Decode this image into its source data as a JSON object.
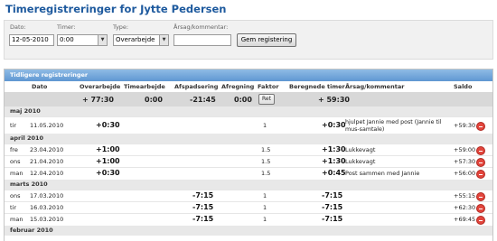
{
  "page_title": "Timeregistreringer for Jytte Pedersen",
  "form": {
    "dato_label": "Dato:",
    "dato_value": "12-05-2010",
    "timer_label": "Timer:",
    "timer_value": "0:00",
    "type_label": "Type:",
    "type_value": "Overarbejde",
    "kommentar_label": "Årsag/kommentar:",
    "kommentar_value": "",
    "submit_label": "Gem registering"
  },
  "panel_title": "Tidligere registreringer",
  "columns": [
    "Dato",
    "Overarbejde",
    "Timearbejde",
    "Afspadsering",
    "Afregning",
    "Faktor",
    "Beregnede timer",
    "Årsag/kommentar",
    "Saldo"
  ],
  "summary": {
    "overarbejde": "+ 77:30",
    "timearbejde": "0:00",
    "afspadsering": "-21:45",
    "afregning": "0:00",
    "faktor_button": "Ret",
    "beregnede": "+ 59:30"
  },
  "months": [
    {
      "name": "maj 2010",
      "rows": [
        {
          "day": "tir",
          "date": "11.05.2010",
          "overarbejde": "+0:30",
          "afspadsering": "",
          "faktor": "1",
          "beregnede": "+0:30",
          "kommentar": "hjulpet Jannie med post (Jannie til mus-samtale)",
          "saldo": "+59:30"
        }
      ]
    },
    {
      "name": "april 2010",
      "rows": [
        {
          "day": "fre",
          "date": "23.04.2010",
          "overarbejde": "+1:00",
          "afspadsering": "",
          "faktor": "1.5",
          "beregnede": "+1:30",
          "kommentar": "Lukkevagt",
          "saldo": "+59:00"
        },
        {
          "day": "ons",
          "date": "21.04.2010",
          "overarbejde": "+1:00",
          "afspadsering": "",
          "faktor": "1.5",
          "beregnede": "+1:30",
          "kommentar": "Lukkevagt",
          "saldo": "+57:30"
        },
        {
          "day": "man",
          "date": "12.04.2010",
          "overarbejde": "+0:30",
          "afspadsering": "",
          "faktor": "1.5",
          "beregnede": "+0:45",
          "kommentar": "Post sammen med Jannie",
          "saldo": "+56:00"
        }
      ]
    },
    {
      "name": "marts 2010",
      "rows": [
        {
          "day": "ons",
          "date": "17.03.2010",
          "overarbejde": "",
          "afspadsering": "-7:15",
          "faktor": "1",
          "beregnede": "-7:15",
          "kommentar": "",
          "saldo": "+55:15"
        },
        {
          "day": "tir",
          "date": "16.03.2010",
          "overarbejde": "",
          "afspadsering": "-7:15",
          "faktor": "1",
          "beregnede": "-7:15",
          "kommentar": "",
          "saldo": "+62:30"
        },
        {
          "day": "man",
          "date": "15.03.2010",
          "overarbejde": "",
          "afspadsering": "-7:15",
          "faktor": "1",
          "beregnede": "-7:15",
          "kommentar": "",
          "saldo": "+69:45"
        }
      ]
    },
    {
      "name": "februar 2010",
      "rows": []
    }
  ]
}
